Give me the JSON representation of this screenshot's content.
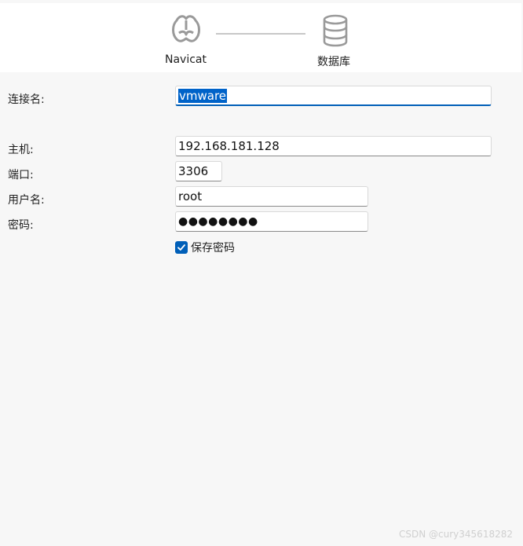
{
  "steps": [
    {
      "label": "Navicat",
      "icon": "navicat-logo-icon"
    },
    {
      "label": "数据库",
      "icon": "database-icon"
    }
  ],
  "form": {
    "connection_name": {
      "label": "连接名:",
      "value": "vmware"
    },
    "host": {
      "label": "主机:",
      "value": "192.168.181.128"
    },
    "port": {
      "label": "端口:",
      "value": "3306"
    },
    "username": {
      "label": "用户名:",
      "value": "root"
    },
    "password": {
      "label": "密码:",
      "value": "●●●●●●●●"
    },
    "save_password": {
      "label": "保存密码",
      "checked": true
    }
  },
  "watermark": "CSDN @cury345618282",
  "colors": {
    "accent": "#005fb8",
    "selection": "#0063c9",
    "background": "#f7f7f7",
    "header_background": "#ffffff"
  }
}
